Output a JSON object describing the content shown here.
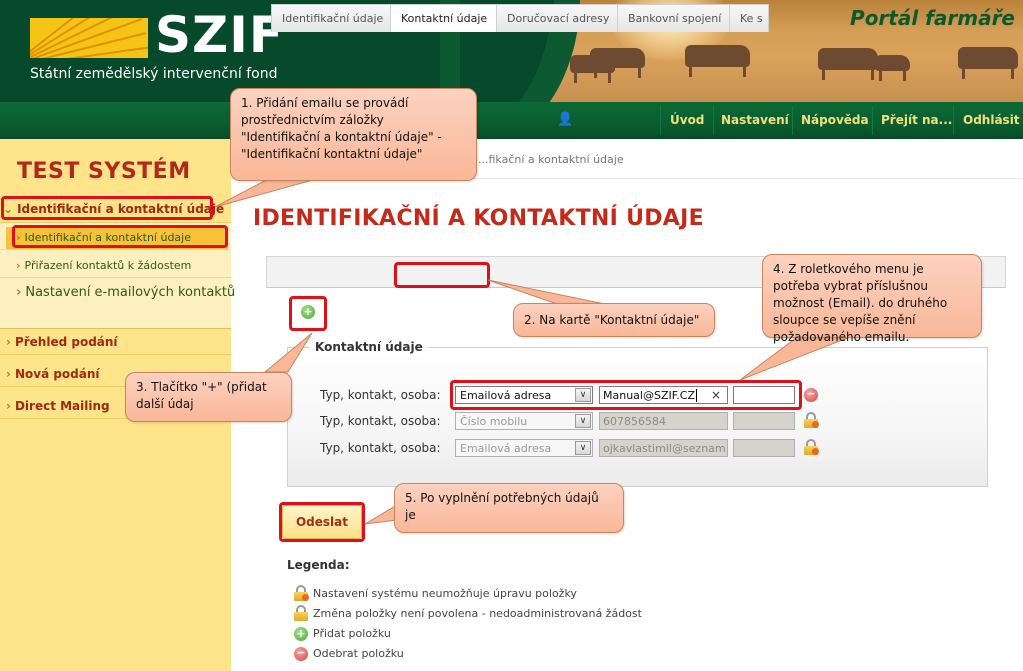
{
  "header": {
    "logo_text": "SZIF",
    "logo_subtitle": "Státní zemědělský intervenční fond",
    "portal_title": "Portál farmáře",
    "user_icon": "user-icon"
  },
  "navbar": {
    "items": [
      {
        "label": "Úvod"
      },
      {
        "label": "Nastavení"
      },
      {
        "label": "Nápověda"
      },
      {
        "label": "Přejít na..."
      },
      {
        "label": "Odhlásit"
      }
    ]
  },
  "sidebar": {
    "system_label": "TEST SYSTÉM",
    "sections": [
      {
        "label": "Identifikační a kontaktní údaje",
        "expanded": true
      },
      {
        "label": "Přehled podání"
      },
      {
        "label": "Nová podání"
      },
      {
        "label": "Direct Mailing"
      }
    ],
    "subitems": [
      {
        "label": "Identifikační a kontaktní údaje",
        "active": true
      },
      {
        "label": "Přiřazení kontaktů k žádostem"
      },
      {
        "label": "Nastavení e-mailových kontaktů"
      }
    ]
  },
  "breadcrumb": "...fikační a kontaktní údaje",
  "page_title": "IDENTIFIKAČNÍ A KONTAKTNÍ ÚDAJE",
  "tabs": [
    {
      "label": "Identifikační údaje"
    },
    {
      "label": "Kontaktní údaje",
      "active": true
    },
    {
      "label": "Doručovací adresy"
    },
    {
      "label": "Bankovní spojení"
    },
    {
      "label": "Ke s"
    }
  ],
  "contact_section": {
    "title": "Kontaktní údaje",
    "rows": [
      {
        "label": "Typ, kontakt, osoba:",
        "type": "Emailová adresa",
        "contact": "Manual@SZIF.CZ",
        "person": "",
        "editable": true,
        "action_icon": "remove-icon"
      },
      {
        "label": "Typ, kontakt, osoba:",
        "type": "Číslo mobilu",
        "contact": "607856584",
        "person": "",
        "editable": false,
        "action_icon": "lock-icon"
      },
      {
        "label": "Typ, kontakt, osoba:",
        "type": "Emailová adresa",
        "contact": "ojkavlastimil@seznam.cz",
        "person": "",
        "editable": false,
        "action_icon": "lock-icon"
      }
    ]
  },
  "submit_label": "Odeslat",
  "legend": {
    "title": "Legenda:",
    "items": [
      {
        "icon": "lock-icon",
        "label": "Nastavení systému neumožňuje úpravu položky"
      },
      {
        "icon": "lock-edit-icon",
        "label": "Změna položky není povolena - nedoadministrovaná žádost"
      },
      {
        "icon": "add-icon",
        "label": "Přidat položku"
      },
      {
        "icon": "remove-icon",
        "label": "Odebrat položku"
      }
    ]
  },
  "callouts": [
    {
      "text": "1. Přidání emailu se provádí prostřednictvím záložky \"Identifikační a kontaktní údaje\" - \"Identifikační kontaktní údaje\""
    },
    {
      "text": "2. Na kartě \"Kontaktní údaje\""
    },
    {
      "text": "3. Tlačítko \"+\" (přidat další údaj"
    },
    {
      "text": "4. Z roletkového menu je potřeba vybrat příslušnou možnost (Email). do druhého sloupce se vepíše znění požadovaného emailu."
    },
    {
      "text": "5. Po vyplnění potřebných údajů je"
    }
  ],
  "colors": {
    "header_green": "#064a2b",
    "nav_text": "#f2e07a",
    "sidebar_bg": "#fde48a",
    "title_red": "#c42a1a",
    "highlight_red": "#e0101a",
    "callout_fill": "#f9b798"
  }
}
